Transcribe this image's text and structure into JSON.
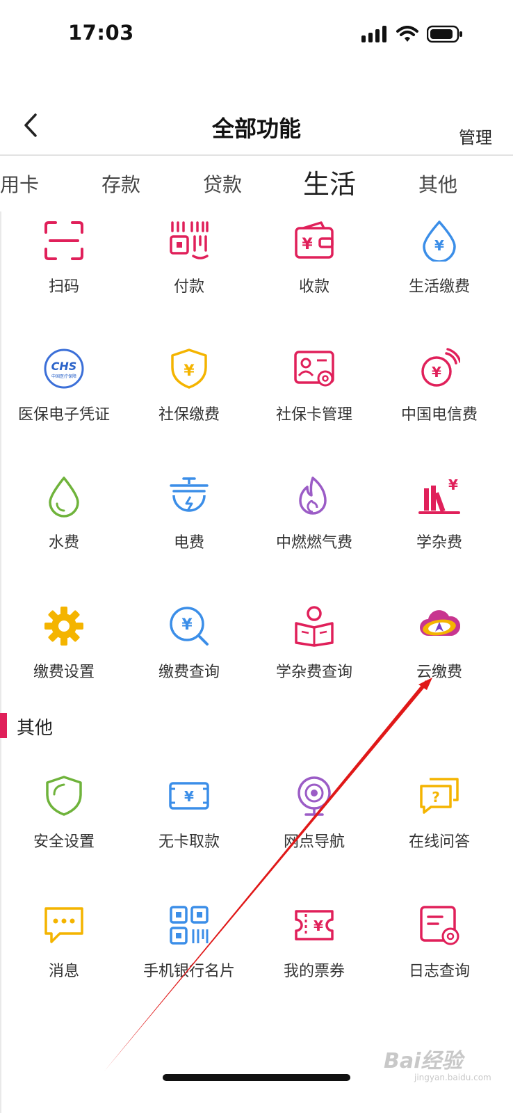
{
  "status_bar": {
    "time": "17:03"
  },
  "nav": {
    "title": "全部功能",
    "manage": "管理"
  },
  "tabs": [
    "用卡",
    "存款",
    "贷款",
    "生活",
    "其他"
  ],
  "active_tab": "生活",
  "life": {
    "items": [
      {
        "label": "扫码",
        "icon": "scan-icon"
      },
      {
        "label": "付款",
        "icon": "payment-code-icon"
      },
      {
        "label": "收款",
        "icon": "receive-money-icon"
      },
      {
        "label": "生活缴费",
        "icon": "utility-bill-icon"
      },
      {
        "label": "医保电子凭证",
        "icon": "medical-insurance-icon",
        "icon_text": "CHS",
        "icon_subtext": "中国医疗保障"
      },
      {
        "label": "社保缴费",
        "icon": "social-security-shield-icon"
      },
      {
        "label": "社保卡管理",
        "icon": "social-security-card-icon"
      },
      {
        "label": "中国电信费",
        "icon": "telecom-fee-icon"
      },
      {
        "label": "水费",
        "icon": "water-drop-icon"
      },
      {
        "label": "电费",
        "icon": "electricity-icon"
      },
      {
        "label": "中燃燃气费",
        "icon": "gas-flame-icon"
      },
      {
        "label": "学杂费",
        "icon": "tuition-books-icon"
      },
      {
        "label": "缴费设置",
        "icon": "gear-icon"
      },
      {
        "label": "缴费查询",
        "icon": "fee-search-icon"
      },
      {
        "label": "学杂费查询",
        "icon": "student-reading-icon"
      },
      {
        "label": "云缴费",
        "icon": "cloud-payment-icon"
      }
    ]
  },
  "other": {
    "title": "其他",
    "items": [
      {
        "label": "安全设置",
        "icon": "security-shield-icon"
      },
      {
        "label": "无卡取款",
        "icon": "cardless-withdrawal-icon"
      },
      {
        "label": "网点导航",
        "icon": "branch-navigation-icon"
      },
      {
        "label": "在线问答",
        "icon": "online-qa-icon"
      },
      {
        "label": "消息",
        "icon": "message-icon"
      },
      {
        "label": "手机银行名片",
        "icon": "qr-business-card-icon"
      },
      {
        "label": "我的票券",
        "icon": "coupon-ticket-icon"
      },
      {
        "label": "日志查询",
        "icon": "log-query-icon"
      }
    ]
  },
  "colors": {
    "brand_red": "#e0205a",
    "blue": "#3b8ee8",
    "yellow": "#f4b400",
    "green": "#6fb33b",
    "purple": "#9b5cc6"
  },
  "watermark": {
    "text": "Bai经验",
    "sub": "jingyan.baidu.com"
  }
}
